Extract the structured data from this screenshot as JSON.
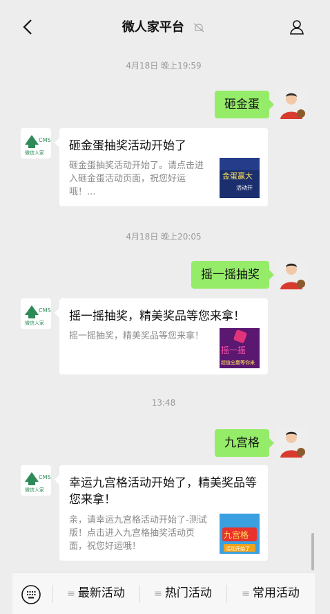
{
  "header": {
    "title": "微人家平台",
    "back_icon": "chevron-left-icon",
    "mute_icon": "bell-mute-icon",
    "profile_icon": "person-icon"
  },
  "logo": {
    "top_text": "CMS",
    "bottom_text": "微信人家",
    "color": "#2e8b57"
  },
  "messages": [
    {
      "time": "4月18日 晚上19:59",
      "sent": "砸金蛋",
      "card": {
        "title": "砸金蛋抽奖活动开始了",
        "desc": "砸金蛋抽奖活动开始了。请点击进入砸金蛋活动页面，祝您好运哦！...",
        "thumb_text": "金蛋赢大",
        "thumb_sub": "活动开"
      }
    },
    {
      "time": "4月18日 晚上20:05",
      "sent": "摇一摇抽奖",
      "card": {
        "title": "摇一摇抽奖，精美奖品等您来拿！",
        "desc": "摇一摇抽奖，精美奖品等您来拿！",
        "thumb_text": "摇一摇",
        "thumb_sub": "超值全赢等你来"
      }
    },
    {
      "time": "13:48",
      "sent": "九宫格",
      "card": {
        "title": "幸运九宫格活动开始了，精美奖品等您来拿！",
        "desc": "亲，请幸运九宫格活动开始了-测试版！点击进入九宫格抽奖活动页面，祝您好运哦！",
        "thumb_text": "九宫格",
        "thumb_sub": "活动开始了"
      }
    }
  ],
  "bottom_bar": {
    "keyboard_icon": "keyboard-icon",
    "menus": [
      "最新活动",
      "热门活动",
      "常用活动"
    ],
    "menu_icon": "≡"
  },
  "colors": {
    "bubble": "#95ec69",
    "background": "#ededed"
  }
}
